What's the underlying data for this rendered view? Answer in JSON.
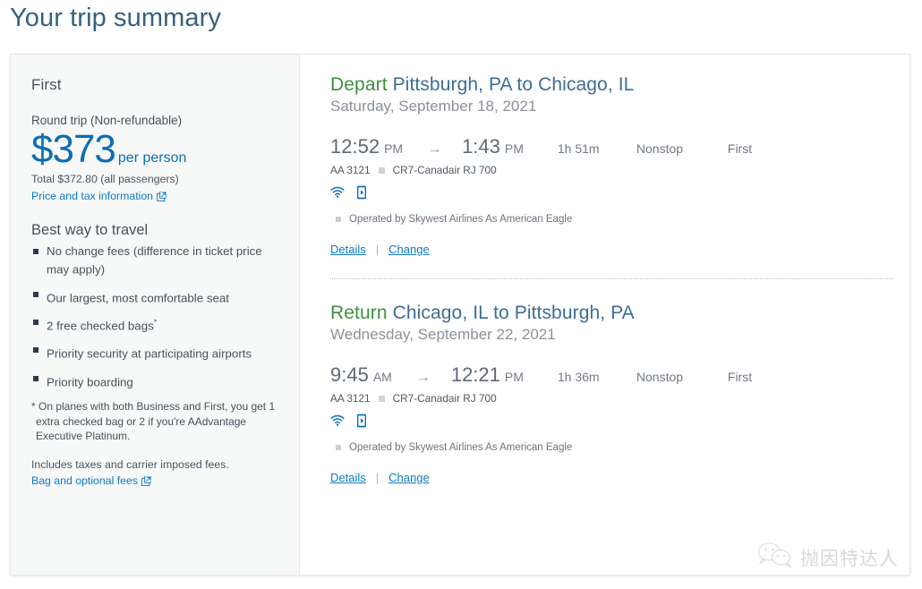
{
  "page": {
    "title": "Your trip summary"
  },
  "fare_summary": {
    "cabin": "First",
    "trip_type": "Round trip (Non-refundable)",
    "price_amount": "$373",
    "price_unit": "per person",
    "total_line": "Total $372.80 (all passengers)",
    "price_tax_link": "Price and tax information",
    "price_tax_link_icon": "external-link-icon",
    "benefits_heading": "Best way to travel",
    "benefits": [
      {
        "text": "No change fees (difference in ticket price may apply)",
        "footnote_mark": ""
      },
      {
        "text": "Our largest, most comfortable seat",
        "footnote_mark": ""
      },
      {
        "text": "2 free checked bags",
        "footnote_mark": "*"
      },
      {
        "text": "Priority security at participating airports",
        "footnote_mark": ""
      },
      {
        "text": "Priority boarding",
        "footnote_mark": ""
      }
    ],
    "footnote": "* On planes with both Business and First, you get 1 extra checked bag or 2 if you're AAdvantage Executive Platinum.",
    "fees_note": "Includes taxes and carrier imposed fees.",
    "bag_fees_link": "Bag and optional fees",
    "bag_fees_link_icon": "external-link-icon"
  },
  "itinerary": {
    "slices": [
      {
        "direction": "Depart",
        "cities": "Pittsburgh, PA to Chicago, IL",
        "date": "Saturday, September 18, 2021",
        "depart_time": "12:52",
        "depart_meridiem": "PM",
        "arrow": "→",
        "arrive_time": "1:43",
        "arrive_meridiem": "PM",
        "duration": "1h 51m",
        "stops": "Nonstop",
        "cabin": "First",
        "flight_number": "AA 3121",
        "equipment": "CR7-Canadair RJ 700",
        "amenities": [
          "wifi-icon",
          "streaming-device-icon"
        ],
        "operated_by": "Operated by Skywest Airlines As American Eagle",
        "details_label": "Details",
        "change_label": "Change",
        "separator": "|"
      },
      {
        "direction": "Return",
        "cities": "Chicago, IL to Pittsburgh, PA",
        "date": "Wednesday, September 22, 2021",
        "depart_time": "9:45",
        "depart_meridiem": "AM",
        "arrow": "→",
        "arrive_time": "12:21",
        "arrive_meridiem": "PM",
        "duration": "1h 36m",
        "stops": "Nonstop",
        "cabin": "First",
        "flight_number": "AA 3121",
        "equipment": "CR7-Canadair RJ 700",
        "amenities": [
          "wifi-icon",
          "streaming-device-icon"
        ],
        "operated_by": "Operated by Skywest Airlines As American Eagle",
        "details_label": "Details",
        "change_label": "Change",
        "separator": "|"
      }
    ]
  },
  "watermark": {
    "icon": "wechat-icon",
    "text": "抛因特达人"
  },
  "colors": {
    "title_blue": "#36617e",
    "price_blue": "#0c6eb5",
    "link_blue": "#0e7ac4",
    "direction_green": "#3f8f3f",
    "cities_blue": "#3e6d94",
    "sidebar_bg": "#f7f8f8"
  }
}
